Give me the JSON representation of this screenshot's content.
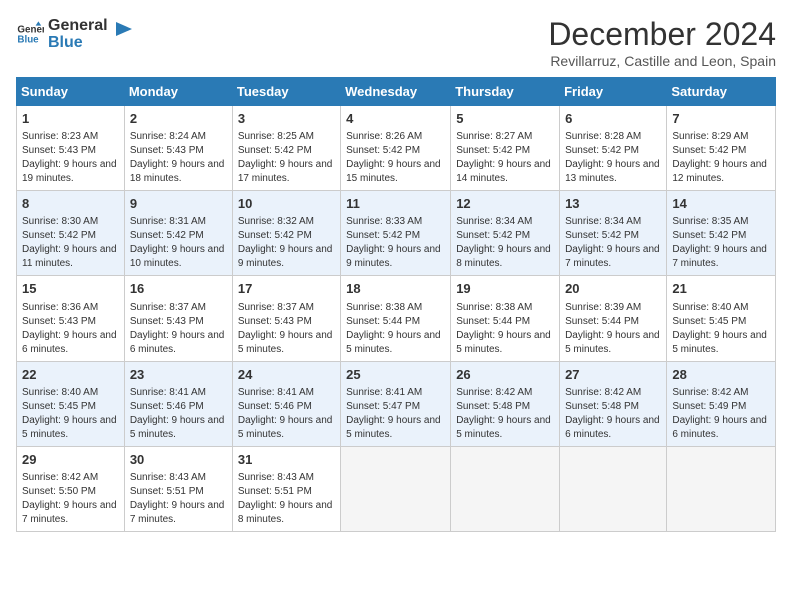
{
  "logo": {
    "line1": "General",
    "line2": "Blue"
  },
  "title": "December 2024",
  "location": "Revillarruz, Castille and Leon, Spain",
  "headers": [
    "Sunday",
    "Monday",
    "Tuesday",
    "Wednesday",
    "Thursday",
    "Friday",
    "Saturday"
  ],
  "weeks": [
    [
      {
        "day": "1",
        "sunrise": "8:23 AM",
        "sunset": "5:43 PM",
        "daylight": "9 hours and 19 minutes."
      },
      {
        "day": "2",
        "sunrise": "8:24 AM",
        "sunset": "5:43 PM",
        "daylight": "9 hours and 18 minutes."
      },
      {
        "day": "3",
        "sunrise": "8:25 AM",
        "sunset": "5:42 PM",
        "daylight": "9 hours and 17 minutes."
      },
      {
        "day": "4",
        "sunrise": "8:26 AM",
        "sunset": "5:42 PM",
        "daylight": "9 hours and 15 minutes."
      },
      {
        "day": "5",
        "sunrise": "8:27 AM",
        "sunset": "5:42 PM",
        "daylight": "9 hours and 14 minutes."
      },
      {
        "day": "6",
        "sunrise": "8:28 AM",
        "sunset": "5:42 PM",
        "daylight": "9 hours and 13 minutes."
      },
      {
        "day": "7",
        "sunrise": "8:29 AM",
        "sunset": "5:42 PM",
        "daylight": "9 hours and 12 minutes."
      }
    ],
    [
      {
        "day": "8",
        "sunrise": "8:30 AM",
        "sunset": "5:42 PM",
        "daylight": "9 hours and 11 minutes."
      },
      {
        "day": "9",
        "sunrise": "8:31 AM",
        "sunset": "5:42 PM",
        "daylight": "9 hours and 10 minutes."
      },
      {
        "day": "10",
        "sunrise": "8:32 AM",
        "sunset": "5:42 PM",
        "daylight": "9 hours and 9 minutes."
      },
      {
        "day": "11",
        "sunrise": "8:33 AM",
        "sunset": "5:42 PM",
        "daylight": "9 hours and 9 minutes."
      },
      {
        "day": "12",
        "sunrise": "8:34 AM",
        "sunset": "5:42 PM",
        "daylight": "9 hours and 8 minutes."
      },
      {
        "day": "13",
        "sunrise": "8:34 AM",
        "sunset": "5:42 PM",
        "daylight": "9 hours and 7 minutes."
      },
      {
        "day": "14",
        "sunrise": "8:35 AM",
        "sunset": "5:42 PM",
        "daylight": "9 hours and 7 minutes."
      }
    ],
    [
      {
        "day": "15",
        "sunrise": "8:36 AM",
        "sunset": "5:43 PM",
        "daylight": "9 hours and 6 minutes."
      },
      {
        "day": "16",
        "sunrise": "8:37 AM",
        "sunset": "5:43 PM",
        "daylight": "9 hours and 6 minutes."
      },
      {
        "day": "17",
        "sunrise": "8:37 AM",
        "sunset": "5:43 PM",
        "daylight": "9 hours and 5 minutes."
      },
      {
        "day": "18",
        "sunrise": "8:38 AM",
        "sunset": "5:44 PM",
        "daylight": "9 hours and 5 minutes."
      },
      {
        "day": "19",
        "sunrise": "8:38 AM",
        "sunset": "5:44 PM",
        "daylight": "9 hours and 5 minutes."
      },
      {
        "day": "20",
        "sunrise": "8:39 AM",
        "sunset": "5:44 PM",
        "daylight": "9 hours and 5 minutes."
      },
      {
        "day": "21",
        "sunrise": "8:40 AM",
        "sunset": "5:45 PM",
        "daylight": "9 hours and 5 minutes."
      }
    ],
    [
      {
        "day": "22",
        "sunrise": "8:40 AM",
        "sunset": "5:45 PM",
        "daylight": "9 hours and 5 minutes."
      },
      {
        "day": "23",
        "sunrise": "8:41 AM",
        "sunset": "5:46 PM",
        "daylight": "9 hours and 5 minutes."
      },
      {
        "day": "24",
        "sunrise": "8:41 AM",
        "sunset": "5:46 PM",
        "daylight": "9 hours and 5 minutes."
      },
      {
        "day": "25",
        "sunrise": "8:41 AM",
        "sunset": "5:47 PM",
        "daylight": "9 hours and 5 minutes."
      },
      {
        "day": "26",
        "sunrise": "8:42 AM",
        "sunset": "5:48 PM",
        "daylight": "9 hours and 5 minutes."
      },
      {
        "day": "27",
        "sunrise": "8:42 AM",
        "sunset": "5:48 PM",
        "daylight": "9 hours and 6 minutes."
      },
      {
        "day": "28",
        "sunrise": "8:42 AM",
        "sunset": "5:49 PM",
        "daylight": "9 hours and 6 minutes."
      }
    ],
    [
      {
        "day": "29",
        "sunrise": "8:42 AM",
        "sunset": "5:50 PM",
        "daylight": "9 hours and 7 minutes."
      },
      {
        "day": "30",
        "sunrise": "8:43 AM",
        "sunset": "5:51 PM",
        "daylight": "9 hours and 7 minutes."
      },
      {
        "day": "31",
        "sunrise": "8:43 AM",
        "sunset": "5:51 PM",
        "daylight": "9 hours and 8 minutes."
      },
      null,
      null,
      null,
      null
    ]
  ],
  "labels": {
    "sunrise": "Sunrise:",
    "sunset": "Sunset:",
    "daylight": "Daylight:"
  }
}
